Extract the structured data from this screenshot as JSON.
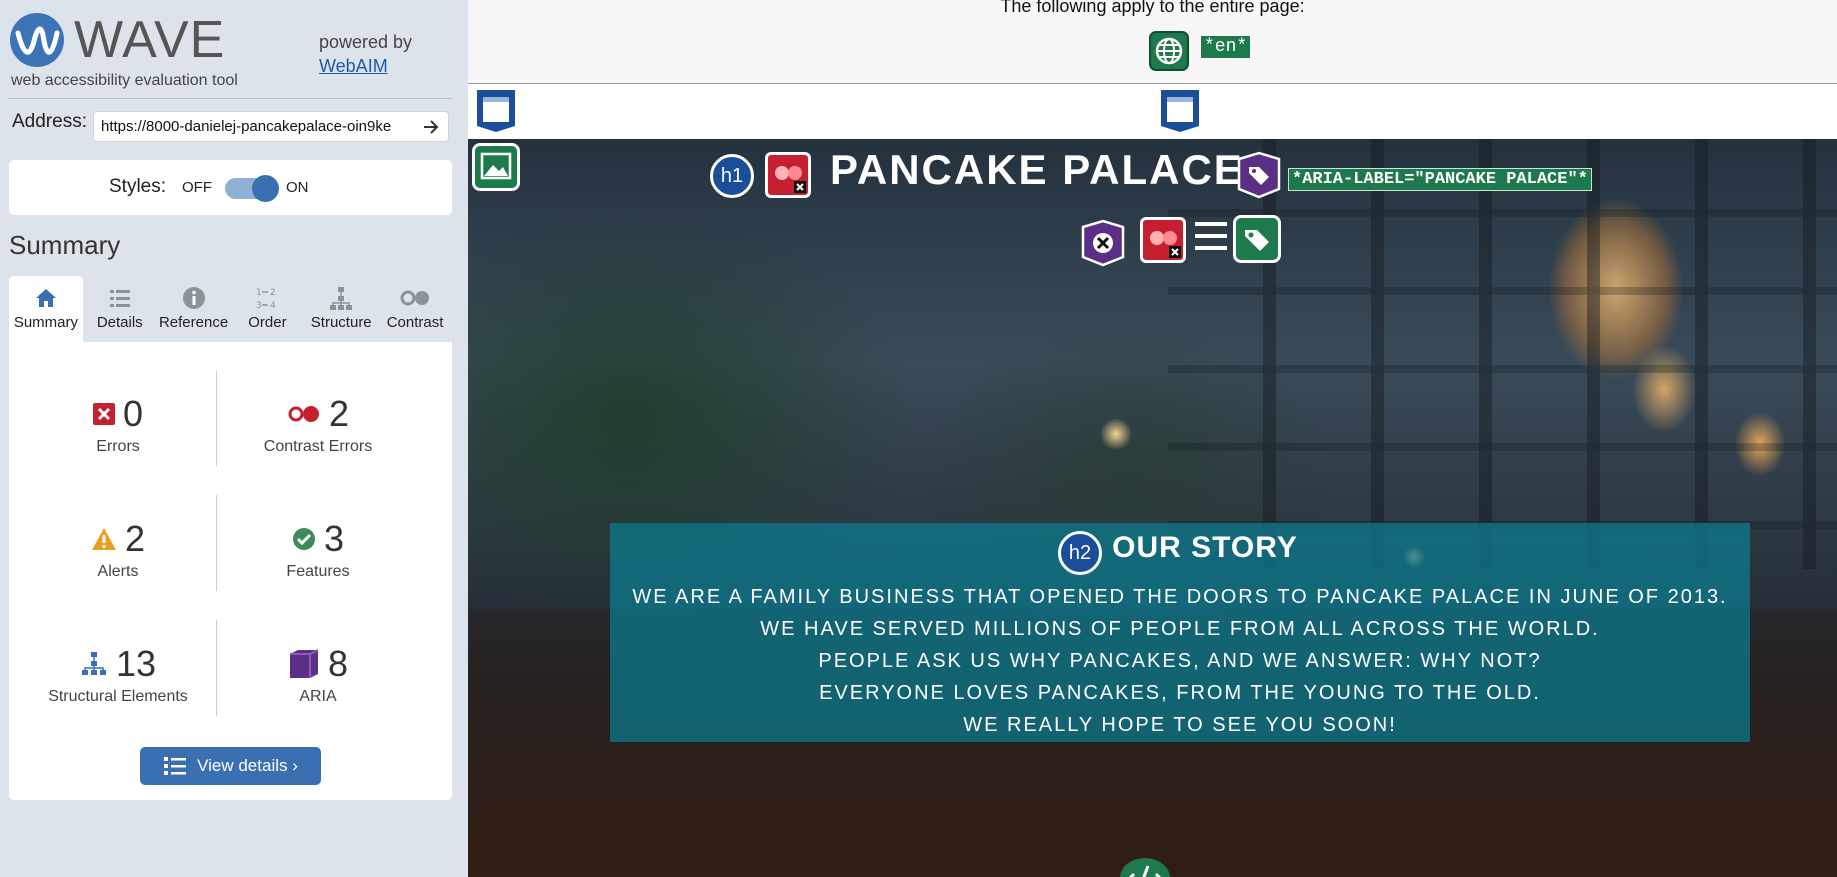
{
  "wave": {
    "logo_text": "WAVE",
    "tagline": "web accessibility evaluation tool",
    "powered_by": "powered by",
    "webaim_link": "WebAIM",
    "address_label": "Address:",
    "address_value": "https://8000-danielej-pancakepalace-oin9ke",
    "styles_label": "Styles:",
    "styles_off": "OFF",
    "styles_on": "ON",
    "summary_heading": "Summary",
    "tabs": [
      {
        "label": "Summary",
        "icon": "home-icon"
      },
      {
        "label": "Details",
        "icon": "list-icon"
      },
      {
        "label": "Reference",
        "icon": "info-icon"
      },
      {
        "label": "Order",
        "icon": "order-icon"
      },
      {
        "label": "Structure",
        "icon": "hierarchy-icon"
      },
      {
        "label": "Contrast",
        "icon": "contrast-icon"
      }
    ],
    "stats": {
      "errors": {
        "count": "0",
        "label": "Errors"
      },
      "contrast_errors": {
        "count": "2",
        "label": "Contrast Errors"
      },
      "alerts": {
        "count": "2",
        "label": "Alerts"
      },
      "features": {
        "count": "3",
        "label": "Features"
      },
      "structural": {
        "count": "13",
        "label": "Structural Elements"
      },
      "aria": {
        "count": "8",
        "label": "ARIA"
      }
    },
    "view_details": "View details ›"
  },
  "page": {
    "page_info": "The following apply to the entire page:",
    "lang_badge": "*en*",
    "site_title": "PANCAKE PALACE",
    "aria_label_badge": "*ARIA-LABEL=\"PANCAKE PALACE\"*",
    "h1": "h1",
    "h2": "h2",
    "story_title": "OUR STORY",
    "story_lines": [
      "WE ARE A FAMILY BUSINESS THAT OPENED THE DOORS TO PANCAKE PALACE IN JUNE OF 2013.",
      "WE HAVE SERVED MILLIONS OF PEOPLE FROM ALL ACROSS THE WORLD.",
      "PEOPLE ASK US WHY PANCAKES, AND WE ANSWER: WHY NOT?",
      "EVERYONE LOVES PANCAKES, FROM THE YOUNG TO THE OLD.",
      "WE REALLY HOPE TO SEE YOU SOON!"
    ]
  },
  "colors": {
    "wave_blue": "#3a6fb2",
    "feature_green": "#1e7a4c",
    "error_red": "#c62030",
    "aria_purple": "#5b2f86",
    "story_teal": "#0b7d91"
  }
}
